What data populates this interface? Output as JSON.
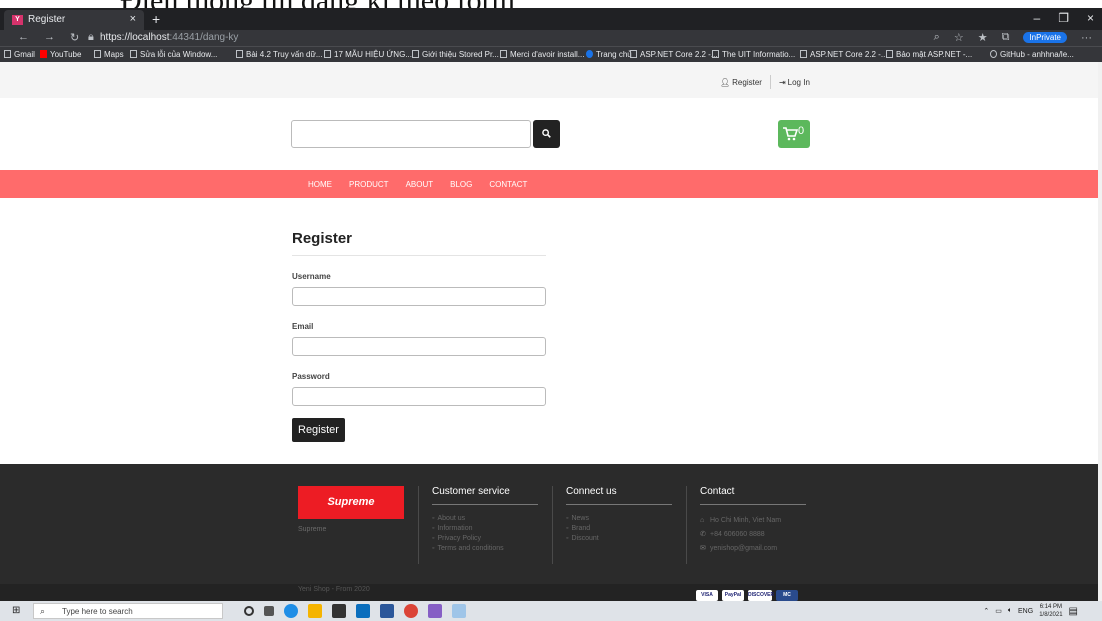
{
  "doc_caption": "Điền thông tin đăng kí theo form",
  "browser": {
    "tab_title": "Register",
    "tab_favicon": "Y",
    "new_tab": "+",
    "close_tab": "×",
    "window_controls": [
      "–",
      "❐",
      "×"
    ],
    "url_main": "https://localhost",
    "url_rest": ":44341/dang-ky",
    "inprivate": "InPrivate",
    "bookmarks": [
      "Gmail",
      "YouTube",
      "Maps",
      "Sửa lỗi của Window...",
      "Bài 4.2 Truy vấn dữ...",
      "17 MẪU HIỆU ỨNG...",
      "Giới thiệu Stored Pr...",
      "Merci d'avoir install...",
      "Trang chủ",
      "ASP.NET Core 2.2 -...",
      "The UIT Informatio...",
      "ASP.NET Core 2.2 -...",
      "Bảo mật ASP.NET -...",
      "GitHub - anhhna/le..."
    ]
  },
  "header": {
    "register_link": "Register",
    "login_link": "Log In",
    "cart_count": "0",
    "search_placeholder": ""
  },
  "nav": {
    "items": [
      "HOME",
      "PRODUCT",
      "ABOUT",
      "BLOG",
      "CONTACT"
    ]
  },
  "form": {
    "title": "Register",
    "username_label": "Username",
    "email_label": "Email",
    "password_label": "Password",
    "submit_label": "Register"
  },
  "footer": {
    "logo_text": "Supreme",
    "logo_caption": "Supreme",
    "customer_service": {
      "title": "Customer service",
      "items": [
        "About us",
        "Information",
        "Privacy Policy",
        "Terms and conditions"
      ]
    },
    "connect": {
      "title": "Connect us",
      "items": [
        "News",
        "Brand",
        "Discount"
      ]
    },
    "contact": {
      "title": "Contact",
      "address": "Ho Chi Minh, Viet Nam",
      "phone": "+84 606060 8888",
      "email": "yenishop@gmail.com"
    },
    "copyright": "Yeni Shop - From 2020",
    "payment_cards": [
      "VISA",
      "PayPal",
      "DISCOVER",
      "MC"
    ]
  },
  "taskbar": {
    "search_placeholder": "Type here to search",
    "language": "ENG",
    "time": "6:14 PM",
    "date": "1/8/2021"
  },
  "colors": {
    "menu_bar": "#ff6b6b",
    "cart_button": "#5cb85c",
    "footer_bg": "#2b2b2b",
    "logo_red": "#ed1c24"
  }
}
